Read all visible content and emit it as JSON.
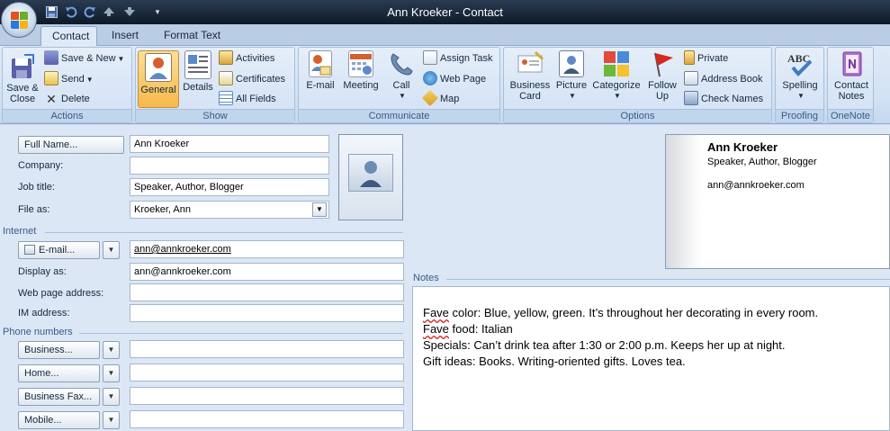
{
  "window": {
    "title": "Ann Kroeker - Contact"
  },
  "colors": {
    "titlebar": "#1b2a3e",
    "ribbon": "#dfeaf7",
    "group_label": "#3b5a82",
    "pressed": "#f7b94a"
  },
  "quick_access": [
    {
      "icon": "save-icon"
    },
    {
      "icon": "undo-icon"
    },
    {
      "icon": "redo-icon"
    },
    {
      "icon": "up-arrow-icon"
    },
    {
      "icon": "down-arrow-icon"
    },
    {
      "icon": "customize-qat-icon"
    }
  ],
  "tabs": [
    {
      "label": "Contact",
      "active": true
    },
    {
      "label": "Insert",
      "active": false
    },
    {
      "label": "Format Text",
      "active": false
    }
  ],
  "ribbon": {
    "actions": {
      "label": "Actions",
      "save_close": "Save & Close",
      "save_new": "Save & New",
      "send": "Send",
      "delete": "Delete"
    },
    "show": {
      "label": "Show",
      "general": "General",
      "details": "Details",
      "activities": "Activities",
      "certificates": "Certificates",
      "all_fields": "All Fields"
    },
    "communicate": {
      "label": "Communicate",
      "email": "E-mail",
      "meeting": "Meeting",
      "call": "Call",
      "assign_task": "Assign Task",
      "web_page": "Web Page",
      "map": "Map"
    },
    "options": {
      "label": "Options",
      "business_card": "Business Card",
      "picture": "Picture",
      "categorize": "Categorize",
      "follow_up": "Follow Up",
      "private": "Private",
      "address_book": "Address Book",
      "check_names": "Check Names"
    },
    "proofing": {
      "label": "Proofing",
      "spelling": "Spelling"
    },
    "onenote": {
      "label": "OneNote",
      "contact_notes": "Contact Notes"
    }
  },
  "form": {
    "full_name_button": "Full Name...",
    "full_name": "Ann Kroeker",
    "company_label": "Company:",
    "company": "",
    "job_title_label": "Job title:",
    "job_title": "Speaker, Author, Blogger",
    "file_as_label": "File as:",
    "file_as": "Kroeker, Ann",
    "internet_section": "Internet",
    "email_button": "E-mail...",
    "email": "ann@annkroeker.com",
    "display_as_label": "Display as:",
    "display_as": "ann@annkroeker.com",
    "web_page_label": "Web page address:",
    "web_page": "",
    "im_label": "IM address:",
    "im": "",
    "phone_section": "Phone numbers",
    "phones": [
      {
        "button": "Business...",
        "value": ""
      },
      {
        "button": "Home...",
        "value": ""
      },
      {
        "button": "Business Fax...",
        "value": ""
      },
      {
        "button": "Mobile...",
        "value": ""
      }
    ]
  },
  "business_card": {
    "name": "Ann Kroeker",
    "title": "Speaker, Author, Blogger",
    "email": "ann@annkroeker.com"
  },
  "notes": {
    "label": "Notes",
    "lines": [
      {
        "prefix": "Fave",
        "rest": " color: Blue, yellow, green. It’s throughout her decorating in every room."
      },
      {
        "prefix": "Fave",
        "rest": " food: Italian"
      },
      {
        "prefix": "",
        "rest": "Specials: Can’t drink tea after 1:30 or 2:00 p.m. Keeps her up at night."
      },
      {
        "prefix": "",
        "rest": "Gift ideas: Books. Writing-oriented gifts. Loves tea."
      }
    ]
  }
}
